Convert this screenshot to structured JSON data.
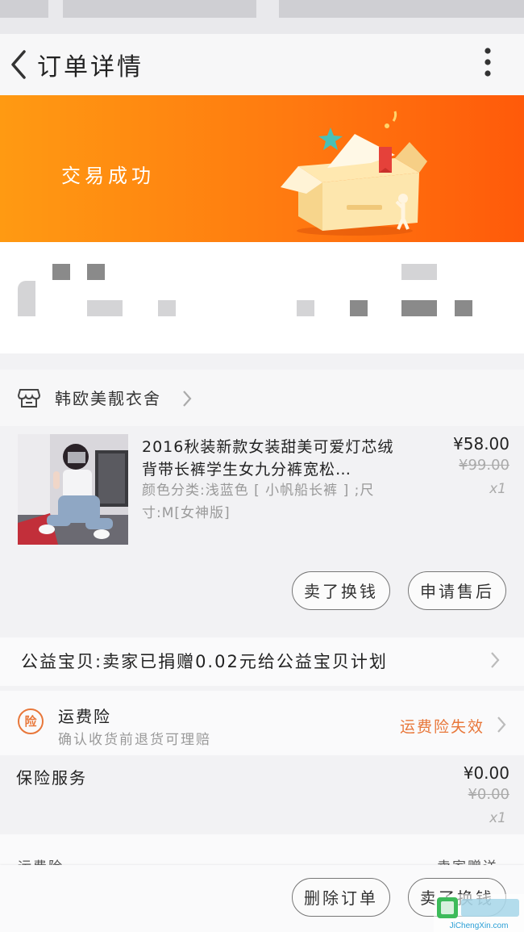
{
  "header": {
    "title": "订单详情"
  },
  "banner": {
    "status_text": "交易成功"
  },
  "store": {
    "name": "韩欧美靓衣舍"
  },
  "item": {
    "title": "2016秋装新款女装甜美可爱灯芯绒背带长裤学生女九分裤宽松…",
    "spec": "颜色分类:浅蓝色 [ 小帆船长裤 ] ;尺寸:M[女神版]",
    "price": "¥58.00",
    "original_price": "¥99.00",
    "quantity": "x1",
    "actions": [
      "卖了换钱",
      "申请售后"
    ]
  },
  "charity": {
    "text": "公益宝贝:卖家已捐赠0.02元给公益宝贝计划"
  },
  "freight_insurance": {
    "icon_text": "险",
    "title": "运费险",
    "subtitle": "确认收货前退货可理赔",
    "status": "运费险失效"
  },
  "insurance_service": {
    "name": "保险服务",
    "price": "¥0.00",
    "original_price": "¥0.00",
    "quantity": "x1"
  },
  "cutoff_row": {
    "left": "运费险",
    "right": "卖家赠送"
  },
  "bottom_bar": {
    "buttons": [
      "删除订单",
      "卖了换钱"
    ]
  },
  "watermark": {
    "brand": "JiChengXin.com"
  },
  "colors": {
    "banner_start": "#ff9a12",
    "banner_end": "#ff5a0a",
    "accent_orange": "#e8773a"
  }
}
